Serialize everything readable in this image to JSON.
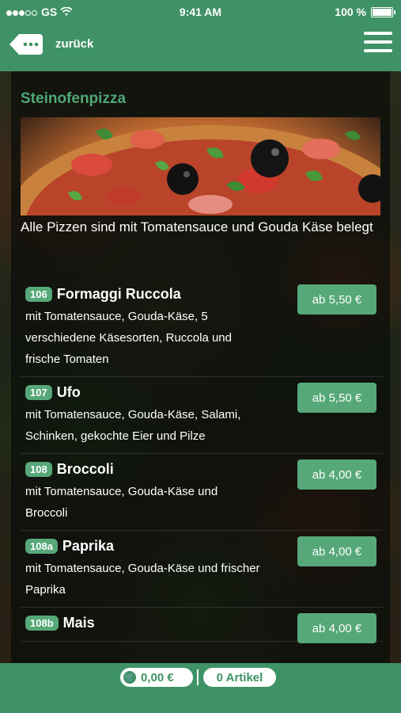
{
  "status_bar": {
    "carrier": "GS",
    "time": "9:41 AM",
    "battery": "100 %"
  },
  "header": {
    "back_label": "zurück"
  },
  "section": {
    "title": "Steinofenpizza",
    "intro": "Alle Pizzen sind mit Tomatensauce und Gouda Käse belegt"
  },
  "items": [
    {
      "number": "106",
      "name": "Formaggi Ruccola",
      "description": "mit Tomatensauce, Gouda-Käse, 5 verschiedene Käsesorten, Ruccola und frische Tomaten",
      "price": "ab 5,50 €"
    },
    {
      "number": "107",
      "name": "Ufo",
      "description": "mit Tomatensauce, Gouda-Käse, Salami, Schinken, gekochte Eier und Pilze",
      "price": "ab 5,50 €"
    },
    {
      "number": "108",
      "name": "Broccoli",
      "description": "mit Tomatensauce, Gouda-Käse und Broccoli",
      "price": "ab 4,00 €"
    },
    {
      "number": "108a",
      "name": "Paprika",
      "description": "mit Tomatensauce, Gouda-Käse und frischer Paprika",
      "price": "ab 4,00 €"
    },
    {
      "number": "108b",
      "name": "Mais",
      "description": "",
      "price": "ab 4,00 €"
    }
  ],
  "cart": {
    "total": "0,00 €",
    "count": "0 Artikel"
  },
  "colors": {
    "primary": "#3f9266",
    "accent": "#56a878",
    "title": "#4fa874"
  }
}
